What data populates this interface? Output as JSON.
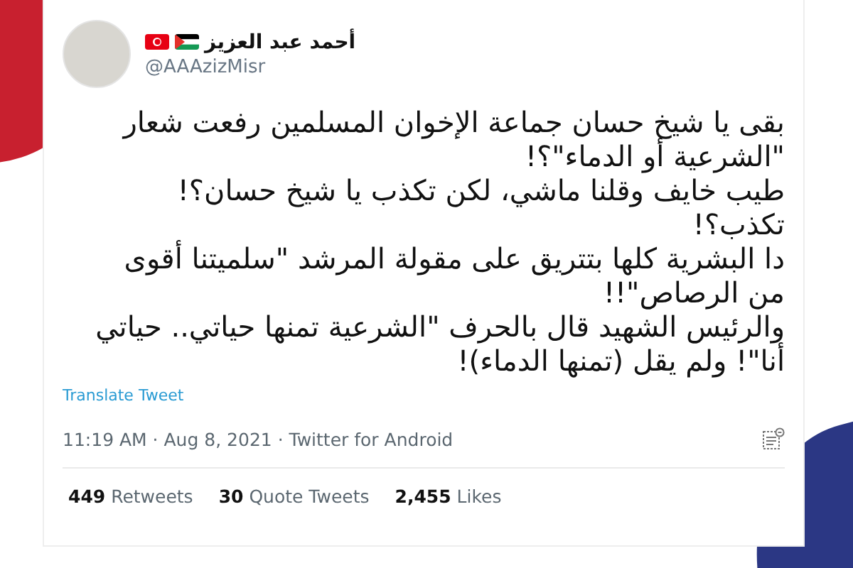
{
  "author": {
    "name": "أحمد عبد العزيز",
    "handle": "@AAAzizMisr"
  },
  "tweet_lines": [
    "بقى يا شيخ حسان جماعة الإخوان المسلمين رفعت شعار",
    "\"الشرعية أو الدماء\"؟!",
    "طيب خايف وقلنا ماشي، لكن تكذب يا شيخ حسان؟!",
    "تكذب؟!",
    "دا البشرية كلها بتتريق على مقولة المرشد \"سلميتنا أقوى",
    "من الرصاص\"!!",
    "والرئيس الشهيد قال بالحرف \"الشرعية تمنها حياتي.. حياتي",
    "أنا\"! ولم يقل (تمنها الدماء)!"
  ],
  "translate_link": "Translate Tweet",
  "meta": "11:19 AM · Aug 8, 2021 · Twitter for Android",
  "stats": {
    "retweets": {
      "count": "449",
      "label": "Retweets"
    },
    "quote_tweets": {
      "count": "30",
      "label": "Quote Tweets"
    },
    "likes": {
      "count": "2,455",
      "label": "Likes"
    }
  }
}
